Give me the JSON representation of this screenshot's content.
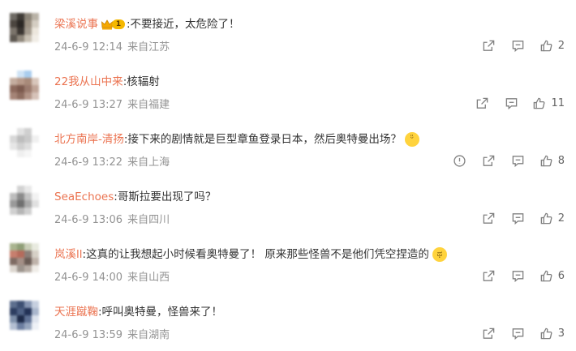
{
  "comments": [
    {
      "user": "梁溪说事",
      "badge_level": "1",
      "text": ":不要接近，太危险了！",
      "time": "24-6-9 12:14",
      "source": "来自江苏",
      "likes": "2",
      "report": false,
      "emoji": null,
      "avatar": [
        "#6e6a64",
        "#3f3b36",
        "#8a8377",
        "#b9b2a6",
        "#4c4640",
        "#2b2724",
        "#9a8f80",
        "#d4cdc2",
        "#7b746b",
        "#3a3531",
        "#a39a8d",
        "#ece6dc",
        "#5d5750",
        "#8f877b",
        "#c8c0b3",
        "#f1ede6"
      ]
    },
    {
      "user": "22我从山中来",
      "text": ":核辐射",
      "time": "24-6-9 13:27",
      "source": "来自福建",
      "likes": "11",
      "report": false,
      "emoji": null,
      "avatar": [
        "#ffffff",
        "#cfe3f5",
        "#a9cdee",
        "#ffffff",
        "#c4ad9f",
        "#b79a8a",
        "#a88a79",
        "#d8c6bb",
        "#8d6a5d",
        "#7c5a4e",
        "#9b7b6e",
        "#bfa497",
        "#a58477",
        "#8e6d60",
        "#b29487",
        "#d6c2b8"
      ]
    },
    {
      "user": "北方南岸-清扬",
      "text": ":接下来的剧情就是巨型章鱼登录日本，然后奥特曼出场？",
      "time": "24-6-9 13:22",
      "source": "来自上海",
      "likes": "8",
      "report": true,
      "emoji": "ᵕ̈",
      "avatar": [
        "#ffffff",
        "#e2e2e2",
        "#cfcfcf",
        "#ffffff",
        "#d8d8d8",
        "#bdbdbd",
        "#c9c9c9",
        "#f0f0f0",
        "#e6e6e6",
        "#d1d1d1",
        "#dedede",
        "#ffffff",
        "#ffffff",
        "#efefef",
        "#f6f6f6",
        "#ffffff"
      ]
    },
    {
      "user": "SeaEchoes",
      "text": ":哥斯拉要出现了吗？",
      "time": "24-6-9 13:06",
      "source": "来自四川",
      "likes": "2",
      "report": false,
      "emoji": null,
      "avatar": [
        "#ffffff",
        "#d2d2d2",
        "#e8e8e8",
        "#ffffff",
        "#bdbdbd",
        "#8b8b8b",
        "#c4c4c4",
        "#f2f2f2",
        "#9a9a9a",
        "#6f6f6f",
        "#a8a8a8",
        "#e0e0e0",
        "#d0d0d0",
        "#b5b5b5",
        "#cfcfcf",
        "#ffffff"
      ]
    },
    {
      "user": "岚溪ll",
      "text": ":这真的让我想起小时候看奥特曼了！ 原来那些怪兽不是他们凭空捏造的",
      "time": "24-6-9 14:00",
      "source": "来自山西",
      "likes": "6",
      "report": false,
      "emoji": "ಥ",
      "avatar": [
        "#a9b48f",
        "#8f9e77",
        "#c9ceb7",
        "#e8eadf",
        "#c77f6e",
        "#b56b5c",
        "#8b7f78",
        "#d6d0c6",
        "#7e6b63",
        "#a38f86",
        "#6a5c55",
        "#bfb3aa",
        "#dcd6cf",
        "#9c948d",
        "#b8aea6",
        "#f0ede8"
      ]
    },
    {
      "user": "天涯蹴鞠",
      "text": ":呼叫奥特曼，怪兽来了！",
      "time": "24-6-9 13:59",
      "source": "来自湖南",
      "likes": "3",
      "report": false,
      "emoji": null,
      "avatar": [
        "#5d6f8e",
        "#3d4f72",
        "#8594b1",
        "#c6cfdf",
        "#2d3e61",
        "#4e6184",
        "#233256",
        "#a9b6cc",
        "#7d8fa9",
        "#1d2a48",
        "#5f7194",
        "#dde3ed",
        "#b3bfd2",
        "#6c7ea0",
        "#95a4bd",
        "#eef1f6"
      ]
    }
  ],
  "icons": {
    "share": "share-icon",
    "comment": "comment-icon",
    "like": "like-icon",
    "report": "report-icon"
  }
}
